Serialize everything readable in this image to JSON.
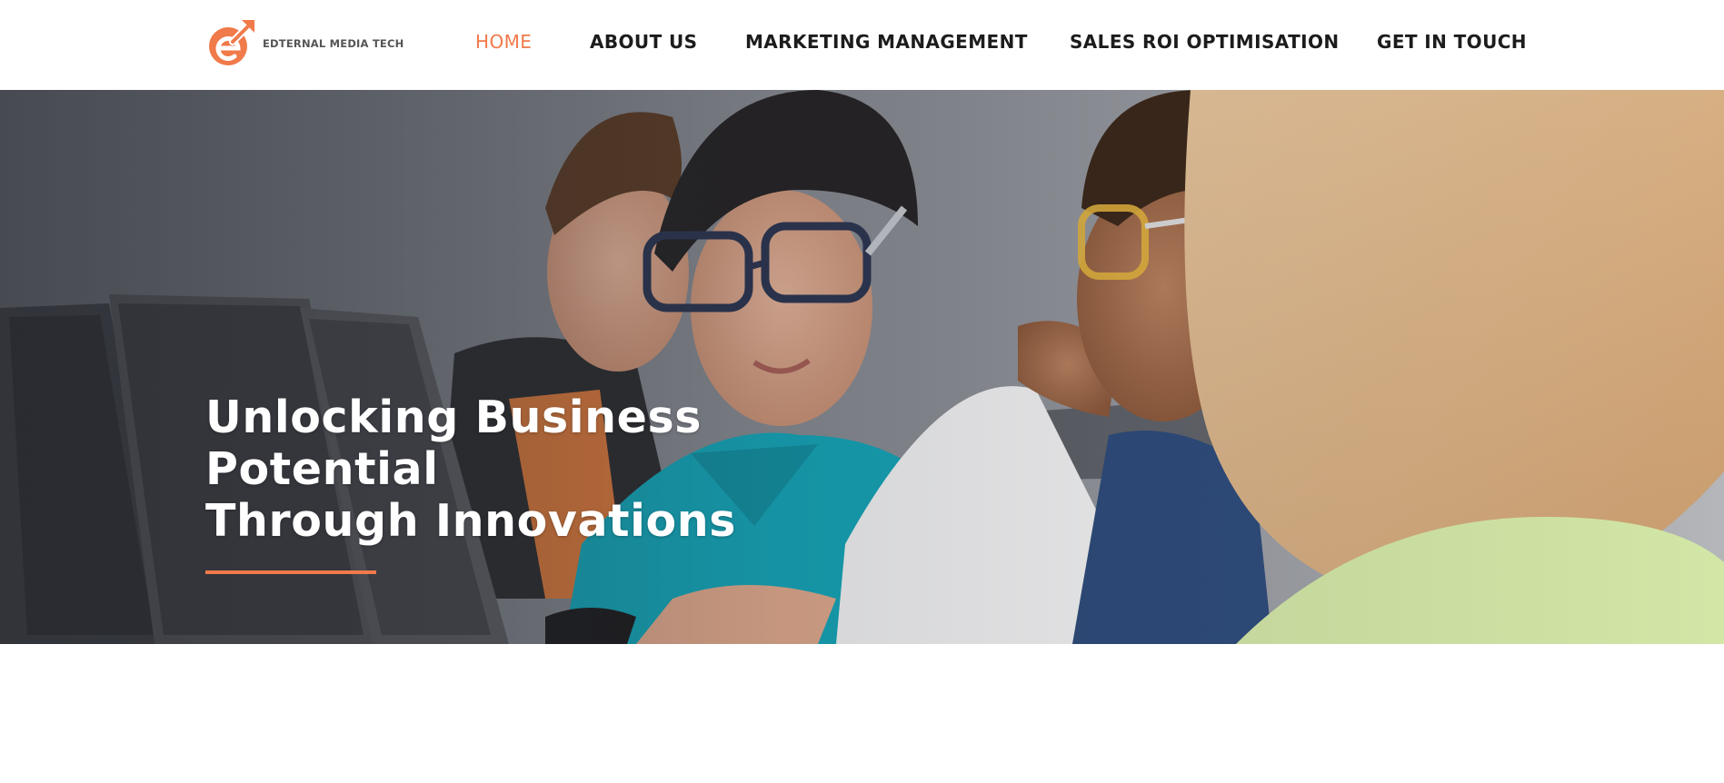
{
  "brand": {
    "logo_text": "EDTERNAL MEDIA TECH",
    "logo_icon": "circular-arrow-e-logo",
    "accent_color": "#f07a4a"
  },
  "nav": {
    "items": [
      {
        "label": "HOME",
        "active": true
      },
      {
        "label": "ABOUT US",
        "active": false
      },
      {
        "label": "MARKETING MANAGEMENT",
        "active": false
      },
      {
        "label": "SALES ROI OPTIMISATION",
        "active": false
      },
      {
        "label": "GET IN TOUCH",
        "active": false
      }
    ],
    "active_color": "#f07a4a",
    "text_color": "#1c1c1c"
  },
  "hero": {
    "title_lines": [
      "Unlocking Business",
      "Potential",
      "Through Innovations"
    ],
    "underline_color": "#f07a4a",
    "image_subject": "children working together at laptops in a classroom"
  }
}
